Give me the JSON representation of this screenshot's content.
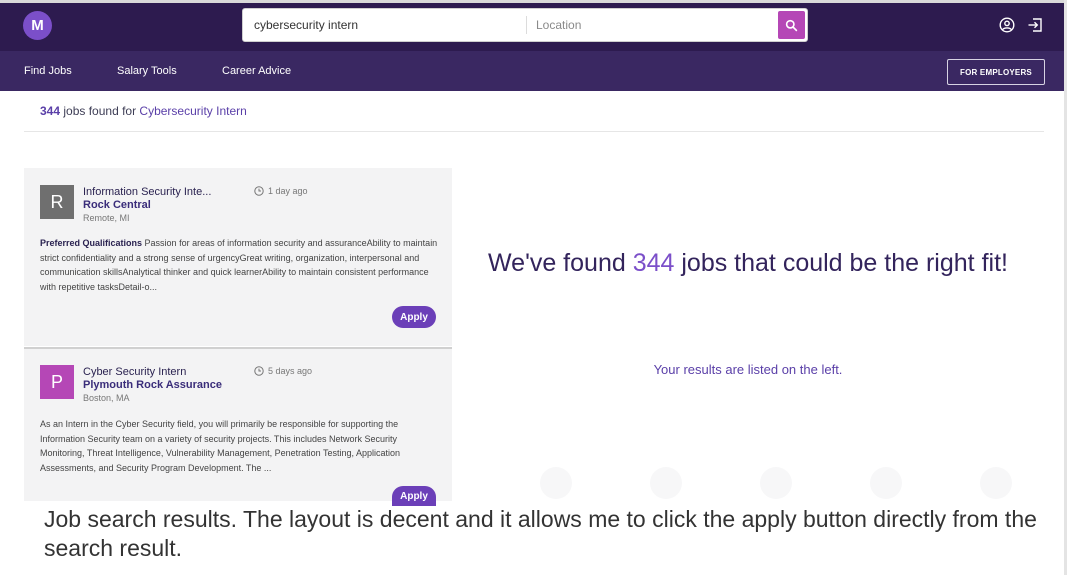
{
  "header": {
    "logo_letter": "M",
    "search": {
      "value": "cybersecurity intern"
    },
    "location": {
      "placeholder": "Location"
    },
    "icons": [
      "search-icon",
      "account-icon",
      "logout-icon"
    ]
  },
  "nav": {
    "items": [
      {
        "label": "Find Jobs"
      },
      {
        "label": "Salary Tools"
      },
      {
        "label": "Career Advice"
      }
    ],
    "employers_label": "FOR EMPLOYERS"
  },
  "results": {
    "count": "344",
    "mid_text": " jobs found for ",
    "query": "Cybersecurity Intern"
  },
  "jobs": [
    {
      "badge": "R",
      "badge_color": "#6f6f6f",
      "title": "Information Security Inte...",
      "company": "Rock Central",
      "location": "Remote, MI",
      "time": "1 day ago",
      "desc_label": "Preferred Qualifications",
      "description": " Passion for areas of information security and assuranceAbility to maintain strict confidentiality and a strong sense of urgencyGreat writing, organization, interpersonal and communication skillsAnalytical thinker and quick learnerAbility to maintain consistent performance with repetitive tasksDetail-o...",
      "apply_label": "Apply"
    },
    {
      "badge": "P",
      "badge_color": "#b547b6",
      "title": "Cyber Security Intern",
      "company": "Plymouth Rock Assurance",
      "location": "Boston, MA",
      "time": "5 days ago",
      "description": "As an Intern in the Cyber Security field, you will primarily be responsible for supporting the Information Security team on a variety of security projects. This includes Network Security Monitoring, Threat Intelligence, Vulnerability Management, Penetration Testing, Application Assessments, and Security Program Development. The ...",
      "apply_label": "Apply"
    }
  ],
  "panel": {
    "title_pre": "We've found ",
    "title_num": "344",
    "title_post": " jobs that could be the right fit!",
    "subtitle": "Your results are listed on the left."
  },
  "caption": "Job search results. The layout is decent and it allows me to click the apply button directly from the search result.",
  "colors": {
    "topbar": "#2d1b4f",
    "navbar": "#3a2862",
    "accent": "#7b4fc9",
    "search_button": "#b547b6",
    "apply_button": "#6b3fb8"
  }
}
